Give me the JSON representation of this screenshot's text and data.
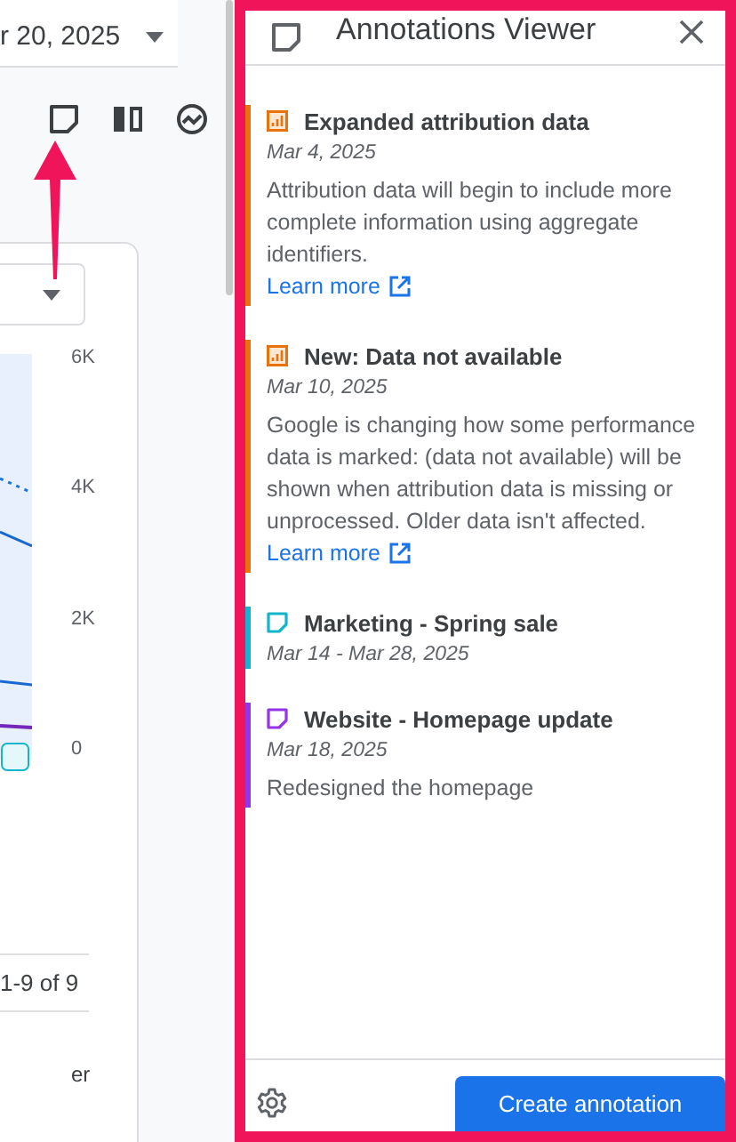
{
  "background": {
    "date_range": "r 20, 2025",
    "axis_labels": [
      "6K",
      "4K",
      "2K",
      "0"
    ],
    "pagination": "1-9 of 9",
    "column_header": "er"
  },
  "panel": {
    "title": "Annotations Viewer",
    "annotations": [
      {
        "kind": "system",
        "color": "#e8710a",
        "title": "Expanded attribution data",
        "date": "Mar 4, 2025",
        "description": "Attribution data will begin to include more complete information using aggregate identifiers.",
        "link": "Learn more"
      },
      {
        "kind": "system",
        "color": "#e8710a",
        "title": "New: Data not available",
        "date": "Mar 10, 2025",
        "description": "Google is changing how some performance data is marked: (data not available) will be shown when attribution data is missing or unprocessed. Older data isn't affected.",
        "link": "Learn more"
      },
      {
        "kind": "note",
        "color": "#12b5cb",
        "title": "Marketing - Spring sale",
        "date": "Mar 14 - Mar 28, 2025"
      },
      {
        "kind": "note",
        "color": "#9334e6",
        "title": "Website - Homepage update",
        "date": "Mar 18, 2025",
        "description": "Redesigned the homepage"
      }
    ],
    "create_button": "Create annotation"
  }
}
